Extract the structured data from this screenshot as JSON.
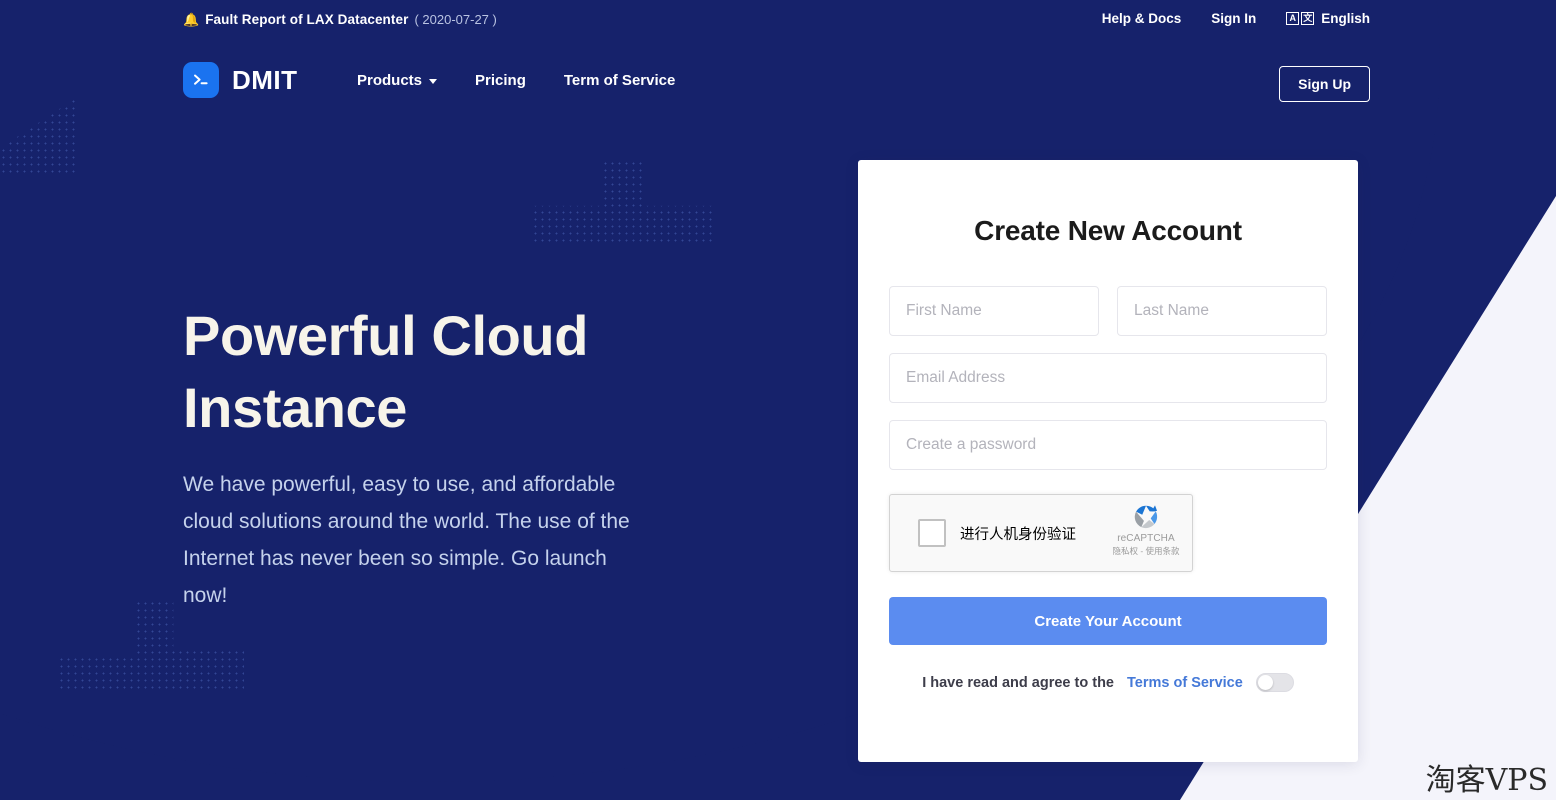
{
  "colors": {
    "navy": "#16226b",
    "page_bg": "#f4f4fb",
    "accent_blue": "#5b8cf0",
    "logo_blue": "#1a73f0",
    "heading_cream": "#f7f4ea",
    "hero_paragraph": "#c5d2ec",
    "link_blue": "#4579d8"
  },
  "announcement": {
    "icon": "bell-icon",
    "title": "Fault Report of LAX Datacenter",
    "date": "( 2020-07-27 )"
  },
  "topbar": {
    "help_label": "Help & Docs",
    "signin_label": "Sign In",
    "language_label": "English",
    "language_icon": "translate-icon",
    "language_icon_glyphs": [
      "A",
      "文"
    ]
  },
  "nav": {
    "brand": "DMIT",
    "brand_icon": "terminal-prompt-icon",
    "links": [
      {
        "label": "Products",
        "has_dropdown": true,
        "icon": "chevron-down-icon"
      },
      {
        "label": "Pricing",
        "has_dropdown": false
      },
      {
        "label": "Term of Service",
        "has_dropdown": false
      }
    ],
    "signup_label": "Sign Up"
  },
  "hero": {
    "heading_line1": "Powerful Cloud",
    "heading_line2": "Instance",
    "paragraph": "We have powerful, easy to use, and affordable cloud solutions around the world. The use of the Internet has never been so simple. Go launch now!"
  },
  "signup_card": {
    "title": "Create New Account",
    "fields": {
      "first_name": {
        "placeholder": "First Name",
        "value": ""
      },
      "last_name": {
        "placeholder": "Last Name",
        "value": ""
      },
      "email": {
        "placeholder": "Email Address",
        "value": ""
      },
      "password": {
        "placeholder": "Create a password",
        "value": ""
      }
    },
    "recaptcha": {
      "label": "进行人机身份验证",
      "brand": "reCAPTCHA",
      "terms": "隐私权 - 使用条款",
      "checked": false,
      "icon": "recaptcha-icon"
    },
    "submit_label": "Create Your Account",
    "terms": {
      "text": "I have read and agree to the",
      "link_label": "Terms of Service",
      "toggle_on": false
    }
  },
  "watermark": "淘客VPS"
}
